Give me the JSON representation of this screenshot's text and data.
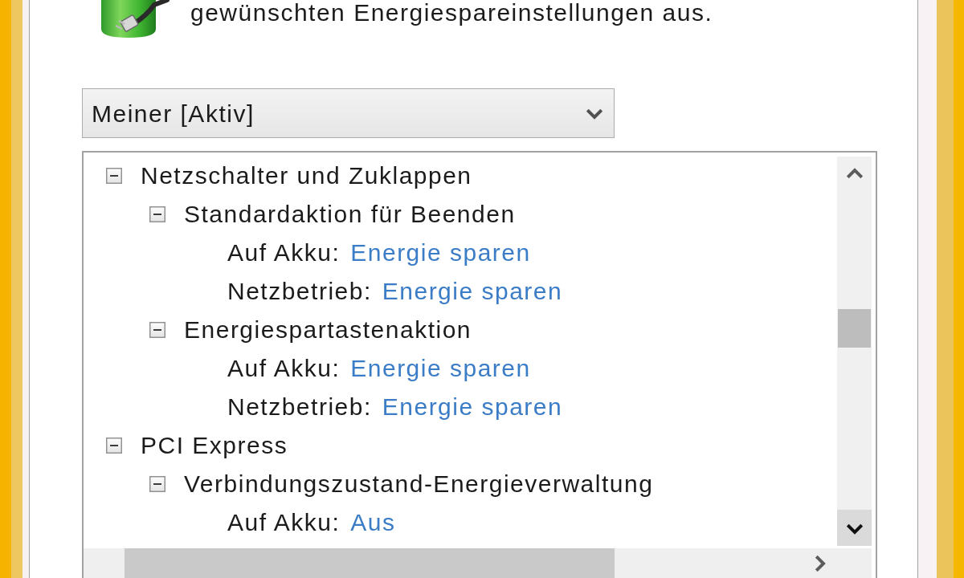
{
  "header": {
    "text": "gewünschten Energiespareinstellungen aus."
  },
  "plan_dropdown": {
    "value": "Meiner [Aktiv]"
  },
  "settings_tree": {
    "items": [
      {
        "label": "Netzschalter und Zuklappen",
        "expanded": true,
        "children": [
          {
            "label": "Standardaktion für Beenden",
            "expanded": true,
            "children": [
              {
                "label": "Auf Akku:",
                "value": "Energie sparen"
              },
              {
                "label": "Netzbetrieb:",
                "value": "Energie sparen"
              }
            ]
          },
          {
            "label": "Energiespartastenaktion",
            "expanded": true,
            "children": [
              {
                "label": "Auf Akku:",
                "value": "Energie sparen"
              },
              {
                "label": "Netzbetrieb:",
                "value": "Energie sparen"
              }
            ]
          }
        ]
      },
      {
        "label": "PCI Express",
        "expanded": true,
        "children": [
          {
            "label": "Verbindungszustand-Energieverwaltung",
            "expanded": true,
            "children": [
              {
                "label": "Auf Akku:",
                "value": "Aus"
              }
            ]
          }
        ]
      }
    ]
  }
}
